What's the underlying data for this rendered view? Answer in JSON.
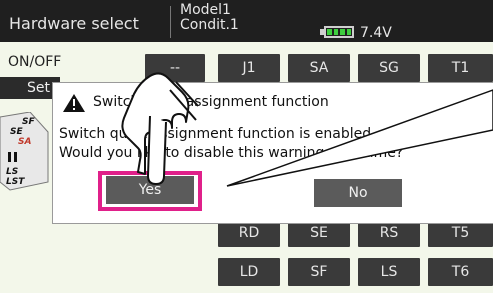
{
  "header": {
    "hardware_select": "Hardware select",
    "model": "Model1",
    "condition": "Condit.1",
    "battery_voltage": "7.4V",
    "battery_color": "#3fce3f"
  },
  "left_panel": {
    "onoff_label": "ON/OFF",
    "set_button": "Set"
  },
  "switch_grid": {
    "row1": [
      "--",
      "J1",
      "SA",
      "SG",
      "T1"
    ],
    "row2": [
      "RD",
      "SE",
      "RS",
      "T5"
    ],
    "row3": [
      "LD",
      "SF",
      "LS",
      "T6"
    ]
  },
  "dialog": {
    "title": "Switch quick assignment function",
    "line1": "Switch quick assignment function is enabled.",
    "line2": "Would you like to disable this warning next time?",
    "yes_label": "Yes",
    "no_label": "No",
    "highlight_color": "#e0208a"
  },
  "icons": {
    "warning": "warning-icon",
    "battery": "battery-icon",
    "pointer": "pointing-hand-icon"
  }
}
